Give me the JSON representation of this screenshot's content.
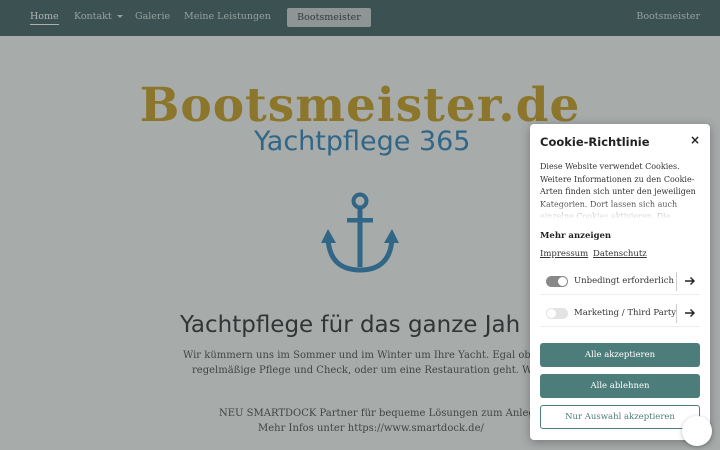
{
  "nav": {
    "items": [
      {
        "label": "Home",
        "active": true
      },
      {
        "label": "Kontakt",
        "dropdown": true
      },
      {
        "label": "Galerie"
      },
      {
        "label": "Meine Leistungen"
      }
    ],
    "button_label": "Bootsmeister",
    "brand": "Bootsmeister"
  },
  "hero": {
    "logo_text": "Bootsmeister.de",
    "logo_subtitle": "Yachtpflege 365",
    "anchor_icon": "anchor-icon",
    "headline": "Yachtpflege für das ganze Jah",
    "paragraph_lines": [
      "Wir kümmern uns im Sommer und im Winter um Ihre Yacht. Egal ob es um ei",
      "regelmäßige Pflege und Check, oder um eine Restauration geht. Wir helfen!"
    ],
    "partner_lines": [
      "NEU SMARTDOCK Partner für bequeme Lösungen zum Anlegen",
      "Mehr Infos unter https://www.smartdock.de/"
    ]
  },
  "cookie": {
    "title": "Cookie-Richtlinie",
    "close": "×",
    "description": "Diese Website verwendet Cookies. Weitere Informationen zu den Cookie-Arten finden sich unter den jeweiligen Kategorien. Dort lassen sich auch einzelne Cookies aktivieren. Die",
    "more": "Mehr anzeigen",
    "links": [
      "Impressum",
      "Datenschutz"
    ],
    "toggles": [
      {
        "label": "Unbedingt erforderlich",
        "on": true
      },
      {
        "label": "Marketing / Third Party",
        "on": false
      }
    ],
    "accept_all": "Alle akzeptieren",
    "reject_all": "Alle ablehnen",
    "accept_selection": "Nur Auswahl akzeptieren"
  },
  "colors": {
    "nav_bg": "#3d5c5c",
    "logo_gold": "#c79a1a",
    "logo_blue": "#2b7fb5",
    "accent": "#4d7d7a"
  }
}
